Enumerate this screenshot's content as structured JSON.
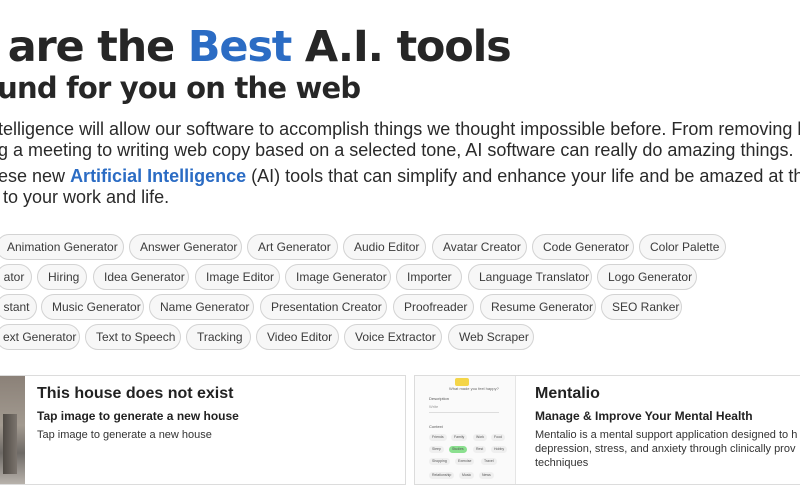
{
  "hero": {
    "title_before": "e are the ",
    "title_accent": "Best",
    "title_after": " A.I. tools",
    "subtitle": "ound for you on the web",
    "para1_line1": "ntelligence will allow our software to accomplish things we thought impossible before. From removing bac",
    "para1_line2": "ng a meeting to writing web copy based on a selected tone, AI software can really do amazing things.",
    "para2_prefix": "hese new ",
    "para2_link": "Artificial Intelligence",
    "para2_suffix": " (AI) tools that can simplify and enhance your life and be amazed at the va",
    "para2_line2": "e to your work and life."
  },
  "tags": [
    [
      "Animation Generator",
      "Answer Generator",
      "Art Generator",
      "Audio Editor",
      "Avatar Creator",
      "Code Generator",
      "Color Palette"
    ],
    [
      "ator",
      "Hiring",
      "Idea Generator",
      "Image Editor",
      "Image Generator",
      "Importer",
      "Language Translator",
      "Logo Generator"
    ],
    [
      "stant",
      "Music Generator",
      "Name Generator",
      "Presentation Creator",
      "Proofreader",
      "Resume Generator",
      "SEO Ranker"
    ],
    [
      "ext Generator",
      "Text to Speech",
      "Tracking",
      "Video Editor",
      "Voice Extractor",
      "Web Scraper"
    ]
  ],
  "cards": [
    {
      "title": "This house does not exist",
      "subtitle": "Tap image to generate a new house",
      "description": "Tap image to generate a new house"
    },
    {
      "title": "Mentalio",
      "subtitle": "Manage & Improve Your Mental Health",
      "description": "Mentalio is a mental support application designed to h depression, stress, and anxiety through clinically prov techniques",
      "thumb": {
        "question": "What made you feel happy?",
        "field_label": "Description",
        "field_hint": "Write",
        "context_label": "Context",
        "chips": [
          "Friends",
          "Family",
          "Work",
          "Food",
          "Sleep",
          "Studies",
          "Rest",
          "Hobby",
          "Shopping",
          "Exercise",
          "Travel",
          "Relationship",
          "Music",
          "News"
        ],
        "active_chip": "Studies"
      }
    }
  ],
  "colors": {
    "accent": "#2b6cc4",
    "tag_border": "#d3d3d3",
    "tag_bg": "#f7f7f7",
    "active_chip": "#8be08f"
  }
}
